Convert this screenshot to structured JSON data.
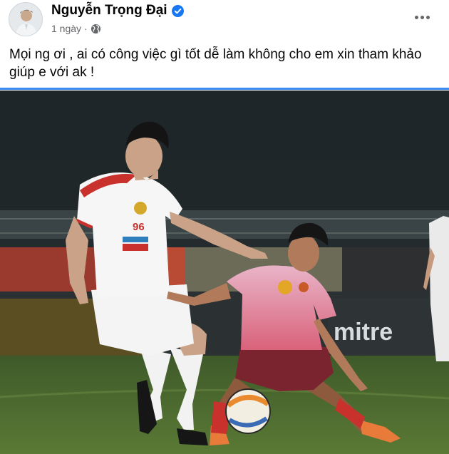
{
  "post": {
    "author_name": "Nguyễn Trọng Đại",
    "time": "1 ngày",
    "separator": "·",
    "privacy_icon": "globe-icon",
    "verified_icon": "verified-badge-icon",
    "more_icon": "more-options-icon",
    "text_line1": "Mọi ng ơi , ai có công việc gì tốt dễ làm không cho em xin tham khảo",
    "text_line2": "giúp e với ak !"
  },
  "photo": {
    "player_left_number": "96",
    "sponsor_visible": "mitre"
  },
  "colors": {
    "verified": "#1877f2",
    "meta": "#65676b",
    "divider": "#1877f2"
  }
}
